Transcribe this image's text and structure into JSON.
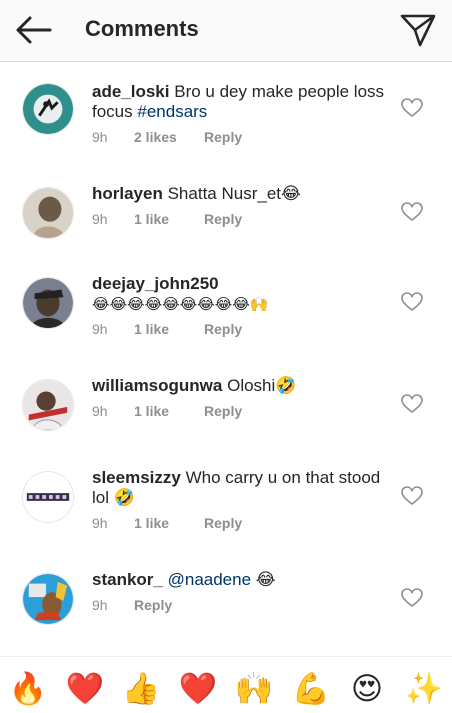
{
  "header": {
    "title": "Comments"
  },
  "comments": [
    {
      "username": "ade_loski",
      "text": "Bro u dey make people loss focus",
      "tag": "#endsars",
      "time": "9h",
      "likes": "2 likes",
      "reply": "Reply",
      "avatar_color": "#2f8f8a"
    },
    {
      "username": "horlayen",
      "text": "Shatta Nusr_et😂",
      "time": "9h",
      "likes": "1 like",
      "reply": "Reply",
      "avatar_color": "#b8a48c"
    },
    {
      "username": "deejay_john250",
      "text": "😂😂😂😂😂😂😂😂😂🙌",
      "time": "9h",
      "likes": "1 like",
      "reply": "Reply",
      "avatar_color": "#5a6070"
    },
    {
      "username": "williamsogunwa",
      "text": "Oloshi🤣",
      "time": "9h",
      "likes": "1 like",
      "reply": "Reply",
      "avatar_color": "#c9c2c2"
    },
    {
      "username": "sleemsizzy",
      "text": "Who carry u on that stood lol 🤣",
      "time": "9h",
      "likes": "1 like",
      "reply": "Reply",
      "avatar_color": "#ffffff"
    },
    {
      "username": "stankor_",
      "mention": "@naadene",
      "text": "😂",
      "time": "9h",
      "reply": "Reply",
      "avatar_color": "#2a9fd8"
    }
  ],
  "reactions": [
    "🔥",
    "❤️",
    "👍",
    "❤️",
    "🙌",
    "💪",
    "😍",
    "✨"
  ],
  "colors": {
    "text": "#262626",
    "meta": "#8e8e8e",
    "hashtag": "#003569",
    "divider": "#dbdbdb"
  }
}
